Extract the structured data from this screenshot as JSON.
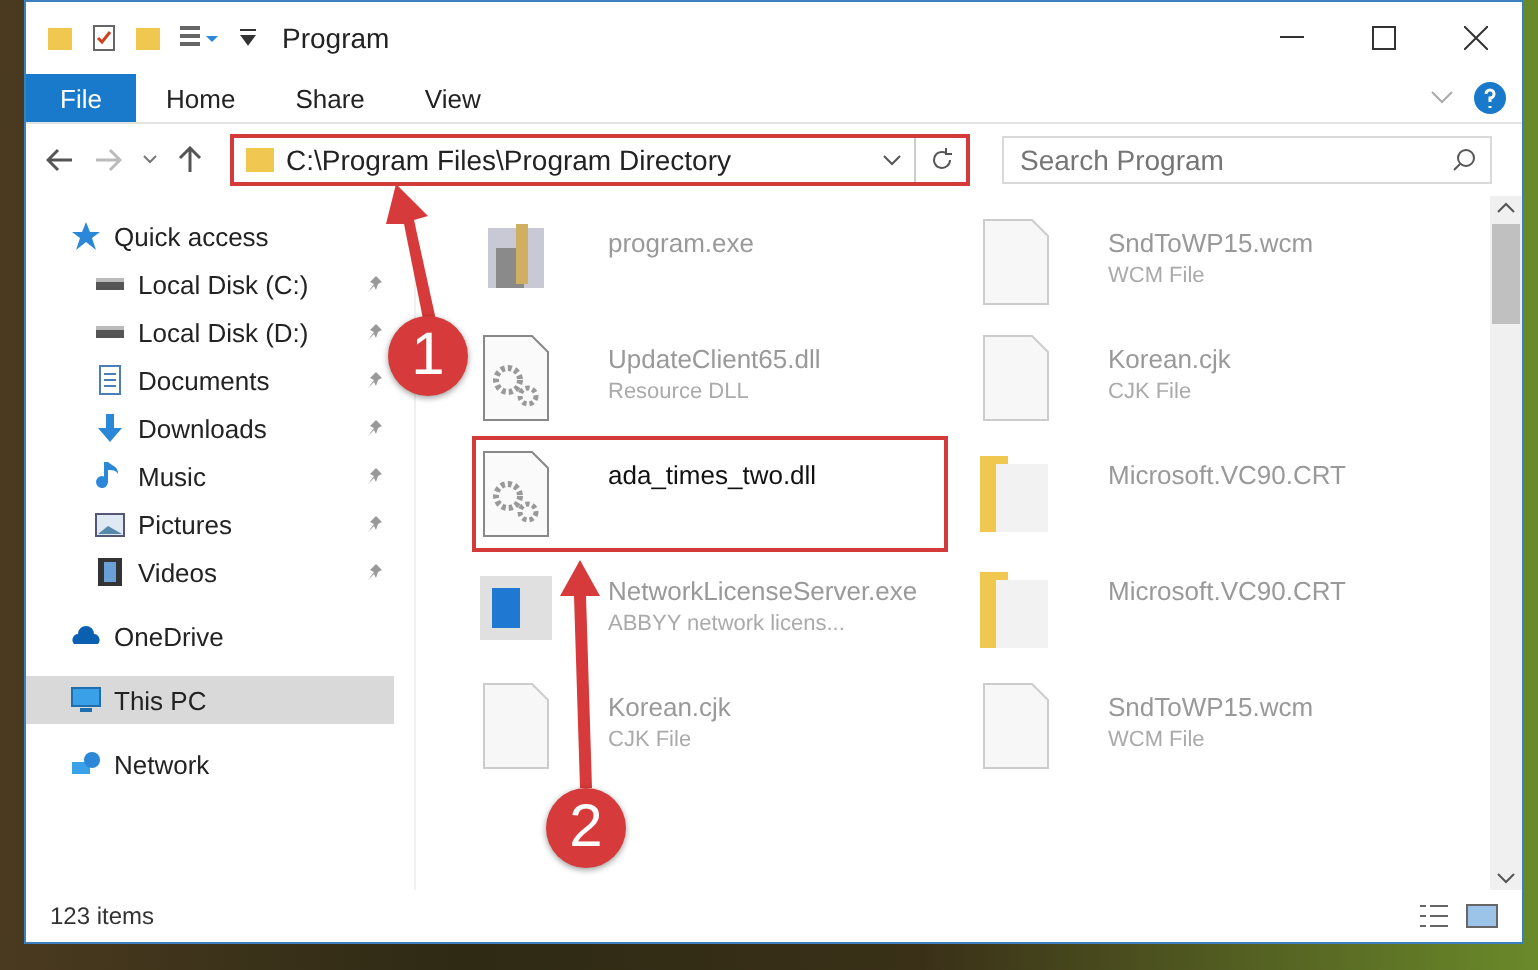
{
  "window": {
    "title": "Program"
  },
  "ribbon": {
    "file_tab": "File",
    "tabs": [
      {
        "label": "Home",
        "selected": false
      },
      {
        "label": "Share",
        "selected": false
      },
      {
        "label": "View",
        "selected": false
      }
    ]
  },
  "address": {
    "path": "C:\\Program Files\\Program Directory",
    "search_placeholder": "Search Program"
  },
  "sidebar": {
    "items": [
      {
        "label": "Quick access",
        "kind": "star",
        "pinned": false,
        "selected": false,
        "children": [
          {
            "label": "Local Disk (C:)",
            "kind": "disk",
            "pinned": true,
            "selected": false
          },
          {
            "label": "Local Disk (D:)",
            "kind": "disk",
            "pinned": true,
            "selected": false
          },
          {
            "label": "Documents",
            "kind": "documents",
            "pinned": true,
            "selected": false
          },
          {
            "label": "Downloads",
            "kind": "download",
            "pinned": true,
            "selected": false
          },
          {
            "label": "Music",
            "kind": "music",
            "pinned": true,
            "selected": false
          },
          {
            "label": "Pictures",
            "kind": "pictures",
            "pinned": true,
            "selected": false
          },
          {
            "label": "Videos",
            "kind": "videos",
            "pinned": true,
            "selected": false
          }
        ]
      },
      {
        "label": "OneDrive",
        "kind": "cloud",
        "pinned": false,
        "selected": false
      },
      {
        "label": "This PC",
        "kind": "pc",
        "pinned": false,
        "selected": true
      },
      {
        "label": "Network",
        "kind": "network",
        "pinned": false,
        "selected": false
      }
    ]
  },
  "files": [
    {
      "name": "program.exe",
      "kind": "exe",
      "highlighted": false
    },
    {
      "name": "SndToWP15.wcm",
      "type": "WCM File",
      "kind": "doc",
      "highlighted": false
    },
    {
      "name": "UpdateClient65.dll",
      "type": "Resource DLL",
      "kind": "dll",
      "highlighted": false
    },
    {
      "name": "Korean.cjk",
      "type": "CJK File",
      "kind": "doc",
      "highlighted": false
    },
    {
      "name": "ada_times_two.dll",
      "kind": "dll",
      "highlighted": true
    },
    {
      "name": "Microsoft.VC90.CRT",
      "kind": "folder",
      "highlighted": false
    },
    {
      "name": "NetworkLicenseServer.exe",
      "type": "ABBYY network licens...",
      "kind": "app",
      "highlighted": false
    },
    {
      "name": "Microsoft.VC90.CRT",
      "kind": "folder",
      "highlighted": false
    },
    {
      "name": "Korean.cjk",
      "type": "CJK File",
      "kind": "doc",
      "highlighted": false
    },
    {
      "name": "SndToWP15.wcm",
      "type": "WCM File",
      "kind": "doc",
      "highlighted": false
    }
  ],
  "callouts": [
    {
      "number": "1"
    },
    {
      "number": "2"
    }
  ],
  "status_bar": {
    "count": "123 items"
  }
}
